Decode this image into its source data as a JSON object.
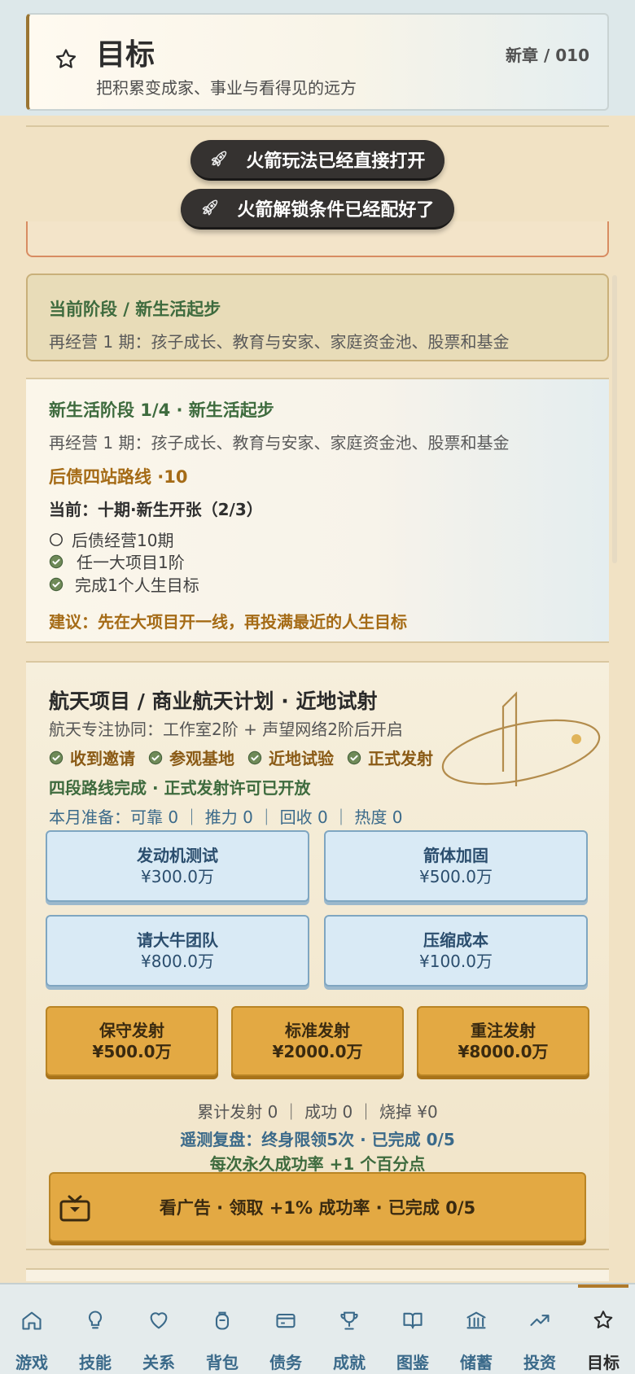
{
  "header": {
    "title": "目标",
    "subtitle": "把积累变成家、事业与看得见的远方",
    "chapter": "新章 / 010"
  },
  "toasts": [
    "火箭玩法已经直接打开",
    "火箭解锁条件已经配好了"
  ],
  "stage": {
    "title": "当前阶段 / 新生活起步",
    "desc": "再经营 1 期：孩子成长、教育与安家、家庭资金池、股票和基金"
  },
  "life": {
    "title": "新生活阶段 1/4 · 新生活起步",
    "desc": "再经营 1 期：孩子成长、教育与安家、家庭资金池、股票和基金",
    "route_title": "后债四站路线  ·10",
    "current": "当前：十期·新生开张（2/3）",
    "tasks": [
      {
        "label": "后债经营10期",
        "done": false
      },
      {
        "label": "任一大项目1阶",
        "done": true
      },
      {
        "label": "完成1个人生目标",
        "done": true
      }
    ],
    "advice": "建议：先在大项目开一线，再投满最近的人生目标"
  },
  "aero": {
    "title": "航天项目 / 商业航天计划 · 近地试射",
    "sub": "航天专注协同：工作室2阶 + 声望网络2阶后开启",
    "steps": [
      "收到邀请",
      "参观基地",
      "近地试验",
      "正式发射"
    ],
    "done_text": "四段路线完成 · 正式发射许可已开放",
    "prep_text": "本月准备：可靠 0 ｜ 推力 0 ｜ 回收 0 ｜ 热度 0",
    "prep_buttons": [
      {
        "name": "发动机测试",
        "cost": "¥300.0万"
      },
      {
        "name": "箭体加固",
        "cost": "¥500.0万"
      },
      {
        "name": "请大牛团队",
        "cost": "¥800.0万"
      },
      {
        "name": "压缩成本",
        "cost": "¥100.0万"
      }
    ],
    "launch_buttons": [
      {
        "name": "保守发射",
        "cost": "¥500.0万"
      },
      {
        "name": "标准发射",
        "cost": "¥2000.0万"
      },
      {
        "name": "重注发射",
        "cost": "¥8000.0万"
      }
    ],
    "stats": "累计发射 0 ｜ 成功 0 ｜ 烧掉 ¥0",
    "review": "遥测复盘：终身限领5次 · 已完成 0/5",
    "bonus": "每次永久成功率 +1 个百分点",
    "ad_label": "看广告 · 领取 +1% 成功率 · 已完成 0/5"
  },
  "nav": [
    {
      "label": "游戏",
      "icon": "home-icon"
    },
    {
      "label": "技能",
      "icon": "lightbulb-icon"
    },
    {
      "label": "关系",
      "icon": "heart-icon"
    },
    {
      "label": "背包",
      "icon": "backpack-icon"
    },
    {
      "label": "债务",
      "icon": "card-icon"
    },
    {
      "label": "成就",
      "icon": "trophy-icon"
    },
    {
      "label": "图鉴",
      "icon": "book-icon"
    },
    {
      "label": "储蓄",
      "icon": "bank-icon"
    },
    {
      "label": "投资",
      "icon": "trend-icon"
    },
    {
      "label": "目标",
      "icon": "star-icon"
    }
  ],
  "active_nav": "目标"
}
